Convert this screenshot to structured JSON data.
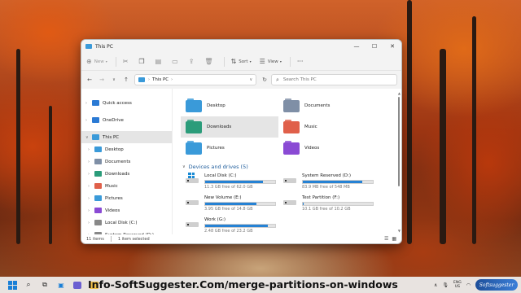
{
  "window": {
    "title": "This PC",
    "controls": {
      "minimize": "—",
      "maximize": "☐",
      "close": "✕"
    }
  },
  "commandbar": {
    "new_label": "New",
    "sort_label": "Sort",
    "view_label": "View",
    "more_label": "···"
  },
  "addressbar": {
    "location": "This PC",
    "search_placeholder": "Search This PC"
  },
  "sidebar": {
    "items": [
      {
        "label": "Quick access",
        "icon": "star-icon",
        "color": "#2b7ad4",
        "level": 0,
        "selected": false
      },
      {
        "label": "OneDrive",
        "icon": "cloud-icon",
        "color": "#2b7ad4",
        "level": 0,
        "selected": false
      },
      {
        "label": "This PC",
        "icon": "computer-icon",
        "color": "#3a9ad9",
        "level": 0,
        "selected": true
      },
      {
        "label": "Desktop",
        "icon": "desktop-icon",
        "color": "#3a9ad9",
        "level": 1,
        "selected": false
      },
      {
        "label": "Documents",
        "icon": "documents-icon",
        "color": "#7f8fa6",
        "level": 1,
        "selected": false
      },
      {
        "label": "Downloads",
        "icon": "downloads-icon",
        "color": "#2b9c7a",
        "level": 1,
        "selected": false
      },
      {
        "label": "Music",
        "icon": "music-icon",
        "color": "#e0604a",
        "level": 1,
        "selected": false
      },
      {
        "label": "Pictures",
        "icon": "pictures-icon",
        "color": "#3a9ad9",
        "level": 1,
        "selected": false
      },
      {
        "label": "Videos",
        "icon": "videos-icon",
        "color": "#8a4ad4",
        "level": 1,
        "selected": false
      },
      {
        "label": "Local Disk (C:)",
        "icon": "drive-icon",
        "color": "#888888",
        "level": 1,
        "selected": false
      },
      {
        "label": "System Reserved (D:)",
        "icon": "drive-icon",
        "color": "#888888",
        "level": 1,
        "selected": false
      }
    ]
  },
  "folders": [
    {
      "label": "Desktop",
      "icon": "desktop-folder-icon",
      "color": "#3a9ad9",
      "selected": false
    },
    {
      "label": "Documents",
      "icon": "documents-folder-icon",
      "color": "#7f8fa6",
      "selected": false
    },
    {
      "label": "Downloads",
      "icon": "downloads-folder-icon",
      "color": "#2b9c7a",
      "selected": true
    },
    {
      "label": "Music",
      "icon": "music-folder-icon",
      "color": "#e0604a",
      "selected": false
    },
    {
      "label": "Pictures",
      "icon": "pictures-folder-icon",
      "color": "#3a9ad9",
      "selected": false
    },
    {
      "label": "Videos",
      "icon": "videos-folder-icon",
      "color": "#8a4ad4",
      "selected": false
    }
  ],
  "drives_section": {
    "header": "Devices and drives (5)"
  },
  "drives": [
    {
      "name": "Local Disk (C:)",
      "free_text": "11.3 GB free of 62.0 GB",
      "used_fraction": 0.82,
      "system": true
    },
    {
      "name": "System Reserved (D:)",
      "free_text": "83.9 MB free of 548 MB",
      "used_fraction": 0.85,
      "system": false
    },
    {
      "name": "New Volume (E:)",
      "free_text": "3.95 GB free of 14.8 GB",
      "used_fraction": 0.73,
      "system": false
    },
    {
      "name": "Test Partition (F:)",
      "free_text": "10.1 GB free of 10.2 GB",
      "used_fraction": 0.01,
      "system": false
    },
    {
      "name": "Work (G:)",
      "free_text": "2.48 GB free of 23.2 GB",
      "used_fraction": 0.89,
      "system": false
    }
  ],
  "statusbar": {
    "item_count": "11 items",
    "selection": "1 item selected"
  },
  "taskbar": {
    "banner": "Info-SoftSuggester.Com/merge-partitions-on-windows",
    "lang_top": "ENG",
    "lang_bottom": "US",
    "badge": "Softsuggester"
  }
}
